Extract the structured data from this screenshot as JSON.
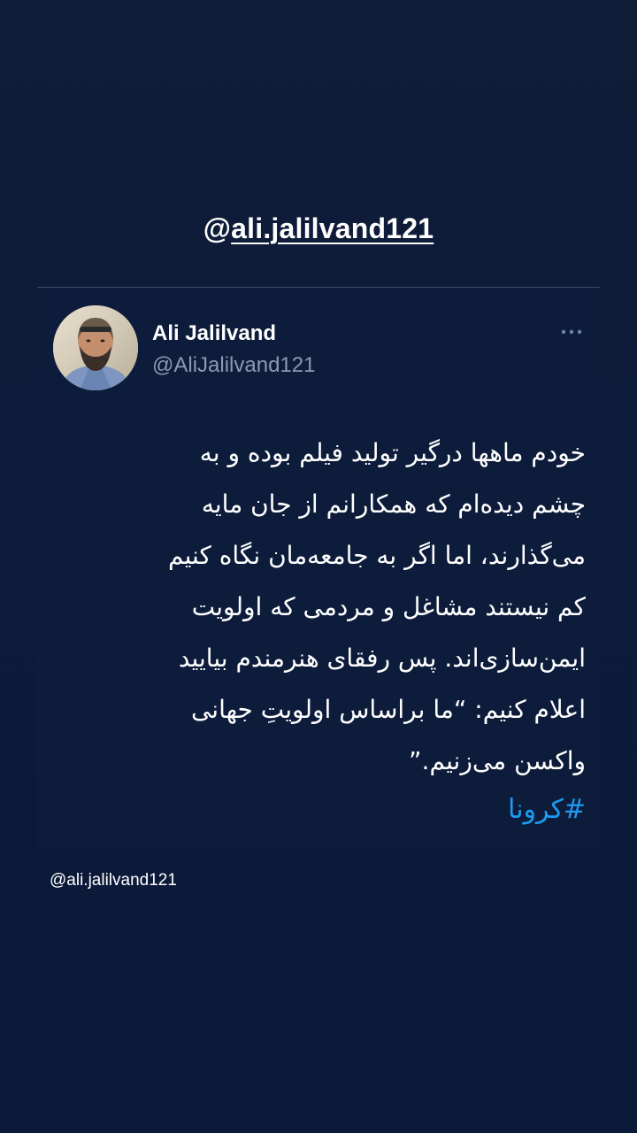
{
  "story": {
    "mention_at": "@",
    "mention_handle": "ali.jalilvand121"
  },
  "tweet": {
    "display_name": "Ali Jalilvand",
    "username": "@AliJalilvand121",
    "more_icon": "more-horizontal-icon",
    "lines": [
      "خودم ماهها درگیر تولید فیلم بوده و به",
      "چشم دیده‌ام که همکارانم از جان مایه",
      "می‌گذارند، اما اگر به جامعه‌مان نگاه کنیم",
      "کم نیستند مشاغل و مردمی که اولویت",
      "ایمن‌سازی‌اند. پس رفقای هنرمندم بیایید",
      "اعلام کنیم: “ما براساس اولویتِ جهانی",
      "واکسن می‌زنیم.”"
    ],
    "hashtag": "#کرونا"
  },
  "watermark": "@ali.jalilvand121",
  "colors": {
    "background": "#0d1b3a",
    "text": "#ffffff",
    "secondary_text": "#8a9ab3",
    "link": "#1d9bf0"
  }
}
